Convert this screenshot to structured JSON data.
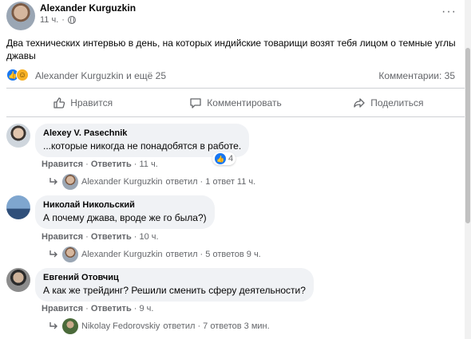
{
  "post": {
    "author": "Alexander Kurguzkin",
    "time": "11 ч.",
    "privacy_icon": "globe-icon",
    "more_icon": "···",
    "text": "Два технических интервью в день, на которых индийские товарищи возят тебя лицом о темные углы джавы",
    "reactions": {
      "icons": [
        "like-icon",
        "haha-icon"
      ],
      "reacted_by": "Alexander Kurguzkin и ещё 25"
    },
    "comments_count": "Комментарии: 35"
  },
  "actions": {
    "like": "Нравится",
    "comment": "Комментировать",
    "share": "Поделиться"
  },
  "comments": [
    {
      "author": "Alexey V. Pasechnik",
      "text": "...которые никогда не понадобятся в работе.",
      "like_label": "Нравится",
      "reply_label": "Ответить",
      "time": "11 ч.",
      "like_count": "4",
      "reply_author": "Alexander Kurguzkin",
      "reply_summary": "ответил · 1 ответ 11 ч."
    },
    {
      "author": "Николай Никольский",
      "text": "А почему джава, вроде же го была?)",
      "like_label": "Нравится",
      "reply_label": "Ответить",
      "time": "10 ч.",
      "reply_author": "Alexander Kurguzkin",
      "reply_summary": "ответил · 5 ответов 9 ч."
    },
    {
      "author": "Евгений Отовчиц",
      "text": "А как же трейдинг? Решили сменить сферу деятельности?",
      "like_label": "Нравится",
      "reply_label": "Ответить",
      "time": "9 ч.",
      "reply_author": "Nikolay Fedorovskiy",
      "reply_summary": "ответил · 7 ответов 3 мин."
    }
  ],
  "colors": {
    "link_gray": "#65676b",
    "bubble": "#f0f2f5",
    "like_blue": "#1877f2",
    "haha_yellow": "#f7b125"
  }
}
